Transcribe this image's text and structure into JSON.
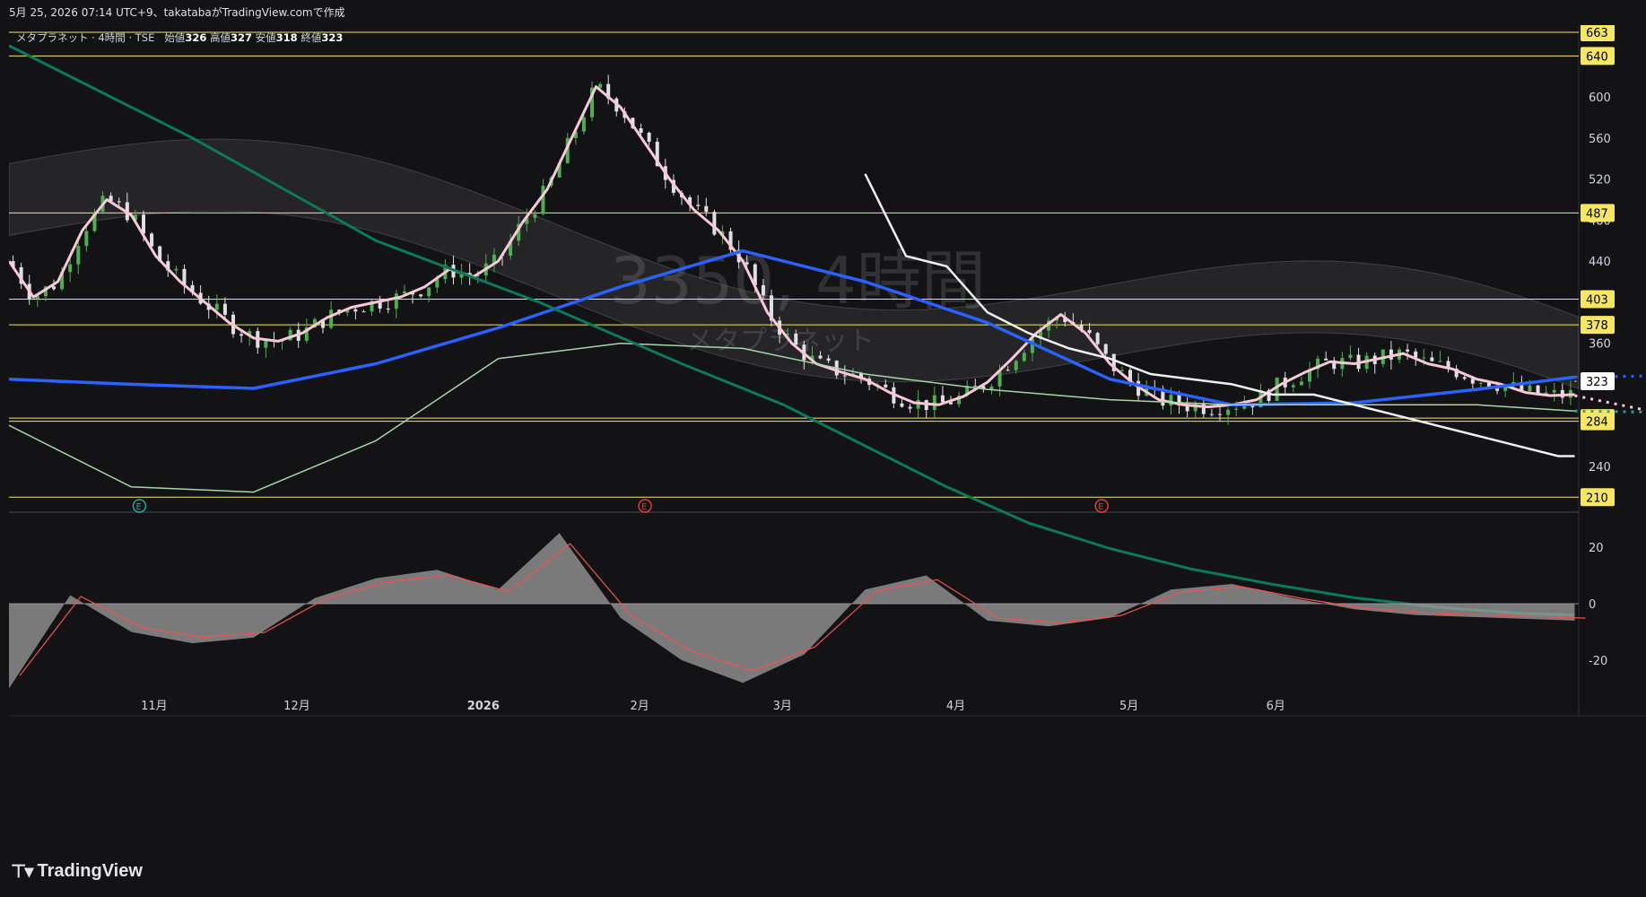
{
  "header": {
    "caption": "5月 25, 2026 07:14 UTC+9、takatabaがTradingView.comで作成"
  },
  "legend": {
    "symbol": "メタプラネット · 4時間 · TSE",
    "open_label": "始値",
    "open": "326",
    "high_label": "高値",
    "high": "327",
    "low_label": "安値",
    "low": "318",
    "close_label": "終値",
    "close": "323"
  },
  "watermark": {
    "ticker": "3350, 4時間",
    "name": "メタプラネット"
  },
  "brand": {
    "name": "TradingView",
    "icon": "tradingview-logo-icon"
  },
  "colors": {
    "background": "#131316",
    "up": "#4caf50",
    "down": "#e0e0e0",
    "pink_ma": "#f8c8d8",
    "blue_ma": "#2962ff",
    "level": "#f5e663",
    "ichimoku": "#f0f0f0"
  },
  "chart_data": {
    "type": "candlestick",
    "price_axis": {
      "ticks": [
        240,
        280,
        320,
        360,
        400,
        440,
        480,
        520,
        560,
        600
      ]
    },
    "horizontal_levels": [
      663,
      640,
      487,
      403,
      378,
      287,
      284,
      210
    ],
    "last_price": 323,
    "x_labels": [
      "11月",
      "12月",
      "2026",
      "2月",
      "3月",
      "4月",
      "5月",
      "6月"
    ],
    "earnings_markers": [
      "E",
      "E",
      "E"
    ],
    "series": [
      {
        "values": [
          [
            0,
            440
          ],
          [
            12,
            405
          ],
          [
            24,
            420
          ],
          [
            36,
            470
          ],
          [
            48,
            500
          ],
          [
            60,
            485
          ],
          [
            72,
            445
          ],
          [
            84,
            420
          ],
          [
            96,
            400
          ],
          [
            108,
            380
          ],
          [
            120,
            365
          ],
          [
            132,
            362
          ],
          [
            144,
            370
          ],
          [
            156,
            385
          ],
          [
            168,
            395
          ],
          [
            180,
            400
          ],
          [
            192,
            405
          ],
          [
            204,
            415
          ],
          [
            216,
            432
          ],
          [
            228,
            425
          ],
          [
            240,
            440
          ],
          [
            252,
            478
          ],
          [
            264,
            510
          ],
          [
            276,
            560
          ],
          [
            288,
            610
          ],
          [
            300,
            590
          ],
          [
            312,
            555
          ],
          [
            324,
            520
          ],
          [
            336,
            490
          ],
          [
            348,
            470
          ],
          [
            360,
            440
          ],
          [
            372,
            390
          ],
          [
            384,
            360
          ],
          [
            396,
            340
          ],
          [
            408,
            332
          ],
          [
            420,
            325
          ],
          [
            432,
            312
          ],
          [
            444,
            302
          ],
          [
            456,
            300
          ],
          [
            468,
            308
          ],
          [
            480,
            322
          ],
          [
            492,
            345
          ],
          [
            504,
            370
          ],
          [
            516,
            388
          ],
          [
            528,
            370
          ],
          [
            540,
            340
          ],
          [
            552,
            320
          ],
          [
            564,
            305
          ],
          [
            576,
            300
          ],
          [
            588,
            298
          ],
          [
            600,
            300
          ],
          [
            612,
            305
          ],
          [
            624,
            320
          ],
          [
            636,
            332
          ],
          [
            648,
            342
          ],
          [
            660,
            340
          ],
          [
            672,
            345
          ],
          [
            684,
            350
          ],
          [
            696,
            340
          ],
          [
            708,
            335
          ],
          [
            720,
            325
          ],
          [
            732,
            320
          ],
          [
            744,
            312
          ],
          [
            756,
            309
          ],
          [
            768,
            310
          ]
        ]
      },
      {
        "values": [
          [
            0,
            325
          ],
          [
            60,
            320
          ],
          [
            120,
            316
          ],
          [
            180,
            340
          ],
          [
            240,
            375
          ],
          [
            300,
            415
          ],
          [
            360,
            450
          ],
          [
            420,
            420
          ],
          [
            480,
            380
          ],
          [
            540,
            325
          ],
          [
            600,
            300
          ],
          [
            660,
            302
          ],
          [
            720,
            315
          ],
          [
            768,
            327
          ]
        ]
      },
      {
        "values": [
          [
            0,
            280
          ],
          [
            60,
            220
          ],
          [
            120,
            215
          ],
          [
            180,
            265
          ],
          [
            240,
            345
          ],
          [
            300,
            360
          ],
          [
            360,
            355
          ],
          [
            420,
            330
          ],
          [
            480,
            315
          ],
          [
            540,
            305
          ],
          [
            600,
            300
          ],
          [
            660,
            300
          ],
          [
            720,
            300
          ],
          [
            768,
            294
          ]
        ]
      },
      {
        "values": [
          [
            420,
            525
          ],
          [
            440,
            445
          ],
          [
            460,
            435
          ],
          [
            480,
            390
          ],
          [
            500,
            370
          ],
          [
            520,
            355
          ],
          [
            540,
            345
          ],
          [
            560,
            330
          ],
          [
            580,
            325
          ],
          [
            600,
            320
          ],
          [
            620,
            310
          ],
          [
            640,
            310
          ],
          [
            660,
            300
          ],
          [
            680,
            290
          ],
          [
            700,
            280
          ],
          [
            720,
            270
          ],
          [
            740,
            260
          ],
          [
            760,
            250
          ],
          [
            768,
            250
          ]
        ]
      },
      {
        "values": [
          [
            0,
            650
          ],
          [
            90,
            560
          ],
          [
            180,
            460
          ],
          [
            260,
            400
          ],
          [
            330,
            340
          ],
          [
            380,
            300
          ],
          [
            420,
            260
          ],
          [
            460,
            220
          ],
          [
            500,
            185
          ],
          [
            540,
            160
          ],
          [
            580,
            140
          ],
          [
            620,
            125
          ],
          [
            660,
            112
          ],
          [
            700,
            103
          ],
          [
            740,
            97
          ],
          [
            768,
            95
          ]
        ]
      }
    ],
    "oscillator": {
      "ticks": [
        20,
        0,
        -20
      ],
      "values": [
        [
          0,
          -30
        ],
        [
          30,
          3
        ],
        [
          60,
          -10
        ],
        [
          90,
          -14
        ],
        [
          120,
          -12
        ],
        [
          150,
          2
        ],
        [
          180,
          9
        ],
        [
          210,
          12
        ],
        [
          240,
          5
        ],
        [
          270,
          25
        ],
        [
          300,
          -5
        ],
        [
          330,
          -20
        ],
        [
          360,
          -28
        ],
        [
          390,
          -18
        ],
        [
          420,
          5
        ],
        [
          450,
          10
        ],
        [
          480,
          -6
        ],
        [
          510,
          -8
        ],
        [
          540,
          -5
        ],
        [
          570,
          5
        ],
        [
          600,
          7
        ],
        [
          630,
          2
        ],
        [
          660,
          -2
        ],
        [
          690,
          -4
        ],
        [
          768,
          -6
        ]
      ]
    }
  }
}
